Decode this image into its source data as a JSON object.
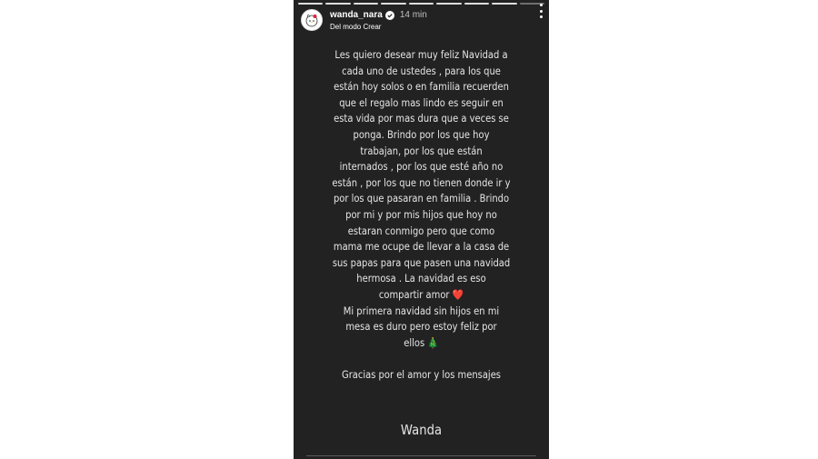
{
  "story": {
    "username": "wanda_nara",
    "time": "14 min",
    "subtitle": "Del modo Crear",
    "progress_segments": 9,
    "lines": [
      "Les quiero desear muy  feliz Navidad a",
      "cada  uno de ustedes , para los que",
      "están hoy solos o en familia recuerden",
      "que el regalo mas lindo es seguir en",
      "esta vida por mas dura que a veces se",
      "ponga. Brindo por los que hoy",
      "trabajan, por los que están",
      "internados , por los que esté año no",
      "están , por los que no tienen donde ir y",
      "por los que pasaran en familia . Brindo",
      "por mi y por mis hijos que hoy no",
      "estaran conmigo pero que como",
      "mama me  ocupe  de llevar a la casa de",
      "sus papas para que pasen una navidad",
      "hermosa   . La navidad es eso",
      "compartir  amor",
      "Mi primera  navidad sin hijos  en mi",
      "mesa es duro   pero  estoy feliz por",
      "ellos",
      "",
      "Gracias por el amor y los mensajes"
    ],
    "heart_emoji": "❤️",
    "tree_emoji": "🎄",
    "signature": "Wanda"
  }
}
